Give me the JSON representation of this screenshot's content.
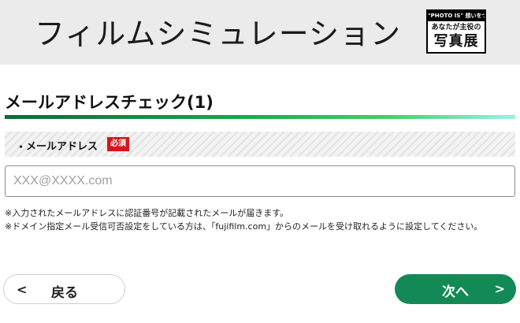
{
  "header": {
    "title": "フィルムシミュレーション",
    "logo": {
      "tagline": "\"PHOTO IS\" 想いをつなぐ。",
      "line1": "あなたが主役の",
      "line2": "写真展"
    }
  },
  "section": {
    "title": "メールアドレスチェック(1)"
  },
  "field": {
    "bullet": "・",
    "label": "メールアドレス",
    "required_badge": "必須",
    "value": "",
    "placeholder": "XXX@XXXX.com"
  },
  "notes": [
    "※入力されたメールアドレスに認証番号が記載されたメールが届きます。",
    "※ドメイン指定メール受信可否設定をしている方は、「fujifilm.com」からのメールを受け取れるように設定してください。"
  ],
  "buttons": {
    "back_label": "戻る",
    "next_label": "次へ"
  },
  "icons": {
    "back": "chevron-left-icon",
    "next": "chevron-right-icon"
  },
  "colors": {
    "accent_green": "#138a55",
    "required_red": "#d7141a",
    "header_bg": "#ebebeb"
  }
}
